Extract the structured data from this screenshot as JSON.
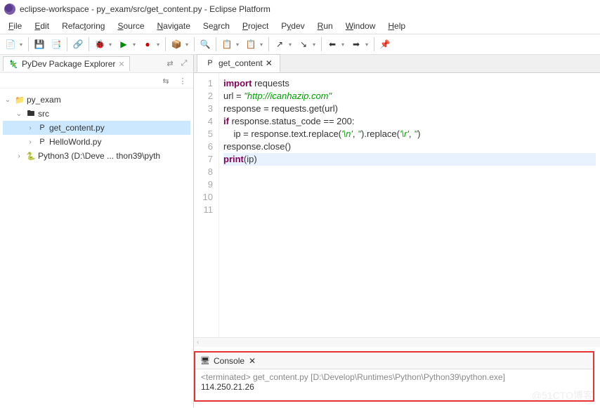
{
  "window": {
    "title": "eclipse-workspace - py_exam/src/get_content.py - Eclipse Platform"
  },
  "menu": [
    "File",
    "Edit",
    "Refactoring",
    "Source",
    "Navigate",
    "Search",
    "Project",
    "Pydev",
    "Run",
    "Window",
    "Help"
  ],
  "explorer": {
    "title": "PyDev Package Explorer",
    "project": "py_exam",
    "src": "src",
    "file_sel": "get_content.py",
    "file2": "HelloWorld.py",
    "python": "Python3 (D:\\Deve ... thon39\\pyth"
  },
  "editor": {
    "tab": "get_content",
    "lines": {
      "l1a": "import",
      "l1b": " requests",
      "l2": "",
      "l3": "",
      "l4a": "url = ",
      "l4b": "\"http://icanhazip.com\"",
      "l5": "response = requests.get(url)",
      "l6": "",
      "l7a": "if",
      "l7b": " response.status_code == 200:",
      "l8a": "    ip = response.text.replace(",
      "l8b": "'\\n'",
      "l8c": ", ",
      "l8d": "''",
      "l8e": ").replace(",
      "l8f": "'\\r'",
      "l8g": ", ",
      "l8h": "''",
      "l8i": ")",
      "l9": "response.close()",
      "l10": "",
      "l11a": "print",
      "l11b": "(ip)"
    },
    "line_nums": [
      "1",
      "2",
      "3",
      "4",
      "5",
      "6",
      "7",
      "8",
      "9",
      "10",
      "11"
    ]
  },
  "console": {
    "title": "Console",
    "status": "<terminated> get_content.py [D:\\Develop\\Runtimes\\Python\\Python39\\python.exe]",
    "output": "114.250.21.26"
  },
  "watermark": "@51CTO博客"
}
